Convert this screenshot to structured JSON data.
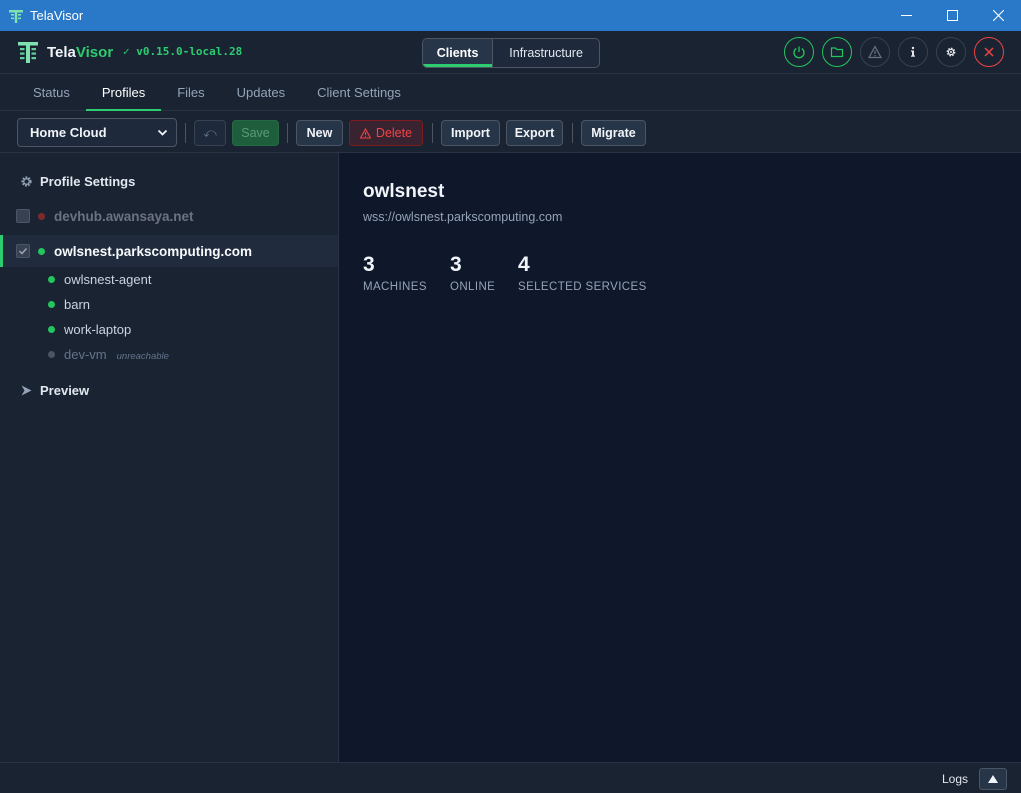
{
  "window": {
    "title": "TelaVisor",
    "controls": [
      "minimize",
      "maximize",
      "close"
    ]
  },
  "header": {
    "brand_first": "Tela",
    "brand_second": "Visor",
    "version": "✓ v0.15.0-local.28",
    "modes": [
      {
        "label": "Clients",
        "active": true
      },
      {
        "label": "Infrastructure",
        "active": false
      }
    ],
    "icons": [
      "power-icon",
      "folder-icon",
      "warning-icon",
      "info-icon",
      "gear-icon",
      "close-icon"
    ]
  },
  "tabs": [
    {
      "label": "Status",
      "active": false
    },
    {
      "label": "Profiles",
      "active": true
    },
    {
      "label": "Files",
      "active": false
    },
    {
      "label": "Updates",
      "active": false
    },
    {
      "label": "Client Settings",
      "active": false
    }
  ],
  "toolbar": {
    "profile_selected": "Home Cloud",
    "undo_glyph": "⤺",
    "save_label": "Save",
    "new_label": "New",
    "delete_label": "Delete",
    "import_label": "Import",
    "export_label": "Export",
    "migrate_label": "Migrate"
  },
  "sidebar": {
    "settings_heading": "Profile Settings",
    "hubs": [
      {
        "name": "devhub.awansaya.net",
        "checked": false,
        "status_color": "#7f2a2a"
      },
      {
        "name": "owlsnest.parkscomputing.com",
        "checked": true,
        "status_color": "#22c55e"
      }
    ],
    "machines": [
      {
        "name": "owlsnest-agent",
        "note": "",
        "status_color": "#22c55e"
      },
      {
        "name": "barn",
        "note": "",
        "status_color": "#22c55e"
      },
      {
        "name": "work-laptop",
        "note": "",
        "status_color": "#22c55e"
      },
      {
        "name": "dev-vm",
        "note": "unreachable",
        "status_color": "#4b5563"
      }
    ],
    "preview_heading": "Preview"
  },
  "main": {
    "hub_title": "owlsnest",
    "hub_url": "wss://owlsnest.parkscomputing.com",
    "stats": [
      {
        "value": "3",
        "label": "MACHINES"
      },
      {
        "value": "3",
        "label": "ONLINE"
      },
      {
        "value": "4",
        "label": "SELECTED SERVICES"
      }
    ]
  },
  "statusbar": {
    "logs_label": "Logs"
  }
}
